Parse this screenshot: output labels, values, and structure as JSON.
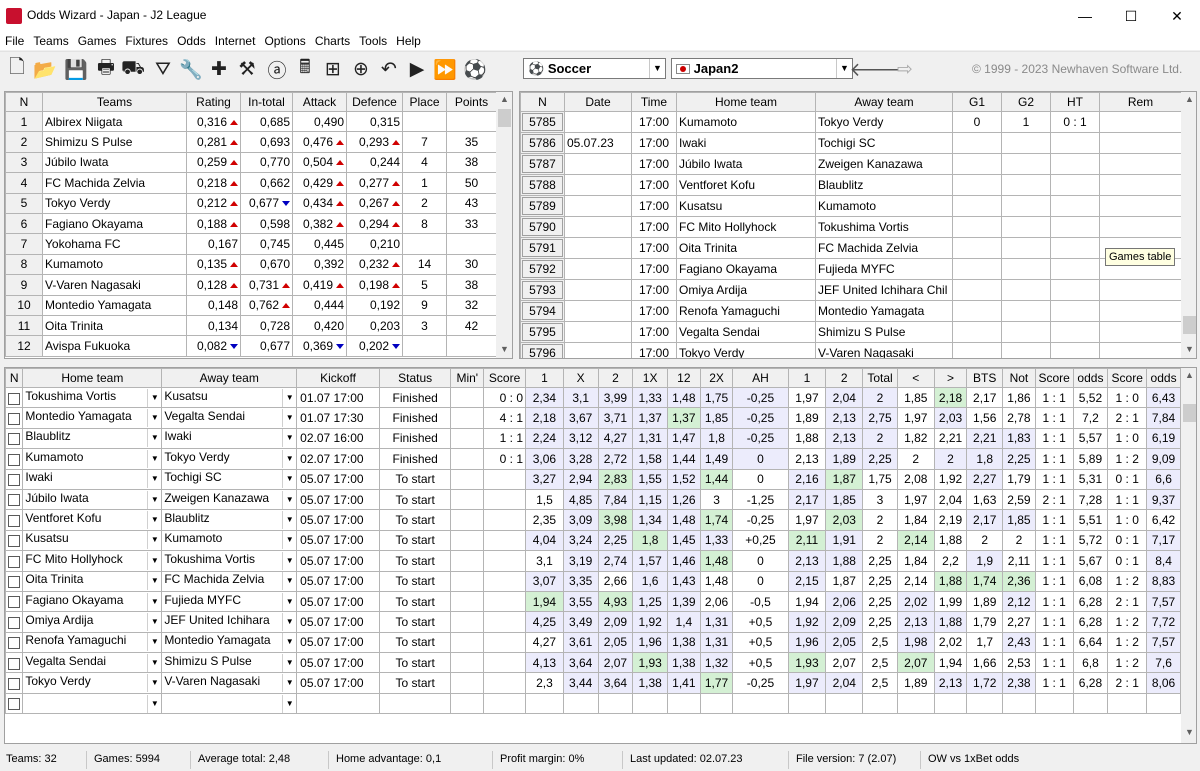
{
  "window": {
    "title": "Odds Wizard - Japan - J2 League",
    "minimize": "—",
    "maximize": "☐",
    "close": "✕"
  },
  "menu": [
    "File",
    "Teams",
    "Games",
    "Fixtures",
    "Odds",
    "Internet",
    "Options",
    "Charts",
    "Tools",
    "Help"
  ],
  "toolbar": {
    "icons": [
      "new-file-icon",
      "open-folder-icon",
      "save-icon",
      "print-icon",
      "print-preview-icon",
      "filter-icon",
      "wrench-icon",
      "medical-cross-icon",
      "tools-icon",
      "ai-icon",
      "calculator-icon",
      "hierarchy-icon",
      "search-icon",
      "undo-icon",
      "play-icon",
      "fast-forward-icon",
      "soccer-ball-icon"
    ],
    "sport": "Soccer",
    "league": "Japan2",
    "back": "🡐",
    "forward": "⇨",
    "copyright": "© 1999 - 2023 Newhaven Software Ltd."
  },
  "teams_table": {
    "headers": [
      "N",
      "Teams",
      "Rating",
      "In-total",
      "Attack",
      "Defence",
      "Place",
      "Points"
    ],
    "rows": [
      [
        "1",
        "Albirex Niigata",
        "0,316",
        "0,685",
        "0,490",
        "0,315",
        "",
        ""
      ],
      [
        "2",
        "Shimizu S Pulse",
        "0,281",
        "0,693",
        "0,476",
        "0,293",
        "7",
        "35"
      ],
      [
        "3",
        "Júbilo Iwata",
        "0,259",
        "0,770",
        "0,504",
        "0,244",
        "4",
        "38"
      ],
      [
        "4",
        "FC Machida Zelvia",
        "0,218",
        "0,662",
        "0,429",
        "0,277",
        "1",
        "50"
      ],
      [
        "5",
        "Tokyo Verdy",
        "0,212",
        "0,677",
        "0,434",
        "0,267",
        "2",
        "43"
      ],
      [
        "6",
        "Fagiano Okayama",
        "0,188",
        "0,598",
        "0,382",
        "0,294",
        "8",
        "33"
      ],
      [
        "7",
        "Yokohama FC",
        "0,167",
        "0,745",
        "0,445",
        "0,210",
        "",
        ""
      ],
      [
        "8",
        "Kumamoto",
        "0,135",
        "0,670",
        "0,392",
        "0,232",
        "14",
        "30"
      ],
      [
        "9",
        "V-Varen Nagasaki",
        "0,128",
        "0,731",
        "0,419",
        "0,198",
        "5",
        "38"
      ],
      [
        "10",
        "Montedio Yamagata",
        "0,148",
        "0,762",
        "0,444",
        "0,192",
        "9",
        "32"
      ],
      [
        "11",
        "Oita Trinita",
        "0,134",
        "0,728",
        "0,420",
        "0,203",
        "3",
        "42"
      ],
      [
        "12",
        "Avispa Fukuoka",
        "0,082",
        "0,677",
        "0,369",
        "0,202",
        "",
        ""
      ]
    ],
    "arrows": [
      [
        "up",
        "",
        "",
        ""
      ],
      [
        "up",
        "",
        "up",
        "up"
      ],
      [
        "up",
        "",
        "up",
        ""
      ],
      [
        "up",
        "",
        "up",
        "up"
      ],
      [
        "up",
        "dn",
        "up",
        "up"
      ],
      [
        "up",
        "",
        "up",
        "up"
      ],
      [
        "",
        "",
        "",
        ""
      ],
      [
        "up",
        "",
        "",
        "up"
      ],
      [
        "up",
        "up",
        "up",
        "up"
      ],
      [
        "",
        "up",
        "",
        ""
      ],
      [
        "",
        "",
        "",
        ""
      ],
      [
        "dn",
        "",
        "dn",
        "dn"
      ]
    ]
  },
  "games_table": {
    "headers": [
      "N",
      "Date",
      "Time",
      "Home team",
      "Away team",
      "G1",
      "G2",
      "HT",
      "Rem"
    ],
    "rows": [
      [
        "5785",
        "",
        "17:00",
        "Kumamoto",
        "Tokyo Verdy",
        "0",
        "1",
        "0 : 1",
        ""
      ],
      [
        "5786",
        "05.07.23",
        "17:00",
        "Iwaki",
        "Tochigi SC",
        "",
        "",
        "",
        ""
      ],
      [
        "5787",
        "",
        "17:00",
        "Júbilo Iwata",
        "Zweigen Kanazawa",
        "",
        "",
        "",
        ""
      ],
      [
        "5788",
        "",
        "17:00",
        "Ventforet Kofu",
        "Blaublitz",
        "",
        "",
        "",
        ""
      ],
      [
        "5789",
        "",
        "17:00",
        "Kusatsu",
        "Kumamoto",
        "",
        "",
        "",
        ""
      ],
      [
        "5790",
        "",
        "17:00",
        "FC Mito Hollyhock",
        "Tokushima Vortis",
        "",
        "",
        "",
        ""
      ],
      [
        "5791",
        "",
        "17:00",
        "Oita Trinita",
        "FC Machida Zelvia",
        "",
        "",
        "",
        ""
      ],
      [
        "5792",
        "",
        "17:00",
        "Fagiano Okayama",
        "Fujieda MYFC",
        "",
        "",
        "",
        ""
      ],
      [
        "5793",
        "",
        "17:00",
        "Omiya Ardija",
        "JEF United Ichihara Chil",
        "",
        "",
        "",
        ""
      ],
      [
        "5794",
        "",
        "17:00",
        "Renofa Yamaguchi",
        "Montedio Yamagata",
        "",
        "",
        "",
        ""
      ],
      [
        "5795",
        "",
        "17:00",
        "Vegalta Sendai",
        "Shimizu S Pulse",
        "",
        "",
        "",
        ""
      ],
      [
        "5796",
        "",
        "17:00",
        "Tokyo Verdy",
        "V-Varen Nagasaki",
        "",
        "",
        "",
        ""
      ]
    ]
  },
  "tooltip": "Games table",
  "fixtures_table": {
    "headers": [
      "N",
      "Home team",
      "Away team",
      "Kickoff",
      "Status",
      "Min'",
      "Score",
      "1",
      "X",
      "2",
      "1X",
      "12",
      "2X",
      "AH",
      "1",
      "2",
      "Total",
      "<",
      ">",
      "BTS",
      "Not",
      "Score",
      "odds",
      "Score",
      "odds"
    ],
    "rows": [
      [
        "Tokushima Vortis",
        "Kusatsu",
        "01.07 17:00",
        "Finished",
        "",
        "0 : 0",
        "2,34",
        "3,1",
        "3,99",
        "1,33",
        "1,48",
        "1,75",
        "-0,25",
        "1,97",
        "2,04",
        "2",
        "1,85",
        "2,18",
        "2,17",
        "1,86",
        "1 : 1",
        "5,52",
        "1 : 0",
        "6,43"
      ],
      [
        "Montedio Yamagata",
        "Vegalta Sendai",
        "01.07 17:30",
        "Finished",
        "",
        "4 : 1",
        "2,18",
        "3,67",
        "3,71",
        "1,37",
        "1,37",
        "1,85",
        "-0,25",
        "1,89",
        "2,13",
        "2,75",
        "1,97",
        "2,03",
        "1,56",
        "2,78",
        "1 : 1",
        "7,2",
        "2 : 1",
        "7,84"
      ],
      [
        "Blaublitz",
        "Iwaki",
        "02.07 16:00",
        "Finished",
        "",
        "1 : 1",
        "2,24",
        "3,12",
        "4,27",
        "1,31",
        "1,47",
        "1,8",
        "-0,25",
        "1,88",
        "2,13",
        "2",
        "1,82",
        "2,21",
        "2,21",
        "1,83",
        "1 : 1",
        "5,57",
        "1 : 0",
        "6,19"
      ],
      [
        "Kumamoto",
        "Tokyo Verdy",
        "02.07 17:00",
        "Finished",
        "",
        "0 : 1",
        "3,06",
        "3,28",
        "2,72",
        "1,58",
        "1,44",
        "1,49",
        "0",
        "2,13",
        "1,89",
        "2,25",
        "2",
        "2",
        "1,8",
        "2,25",
        "1 : 1",
        "5,89",
        "1 : 2",
        "9,09"
      ],
      [
        "Iwaki",
        "Tochigi SC",
        "05.07 17:00",
        "To start",
        "",
        "",
        "3,27",
        "2,94",
        "2,83",
        "1,55",
        "1,52",
        "1,44",
        "0",
        "2,16",
        "1,87",
        "1,75",
        "2,08",
        "1,92",
        "2,27",
        "1,79",
        "1 : 1",
        "5,31",
        "0 : 1",
        "6,6"
      ],
      [
        "Júbilo Iwata",
        "Zweigen Kanazawa",
        "05.07 17:00",
        "To start",
        "",
        "",
        "1,5",
        "4,85",
        "7,84",
        "1,15",
        "1,26",
        "3",
        "-1,25",
        "2,17",
        "1,85",
        "3",
        "1,97",
        "2,04",
        "1,63",
        "2,59",
        "2 : 1",
        "7,28",
        "1 : 1",
        "9,37"
      ],
      [
        "Ventforet Kofu",
        "Blaublitz",
        "05.07 17:00",
        "To start",
        "",
        "",
        "2,35",
        "3,09",
        "3,98",
        "1,34",
        "1,48",
        "1,74",
        "-0,25",
        "1,97",
        "2,03",
        "2",
        "1,84",
        "2,19",
        "2,17",
        "1,85",
        "1 : 1",
        "5,51",
        "1 : 0",
        "6,42"
      ],
      [
        "Kusatsu",
        "Kumamoto",
        "05.07 17:00",
        "To start",
        "",
        "",
        "4,04",
        "3,24",
        "2,25",
        "1,8",
        "1,45",
        "1,33",
        "+0,25",
        "2,11",
        "1,91",
        "2",
        "2,14",
        "1,88",
        "2",
        "2",
        "1 : 1",
        "5,72",
        "0 : 1",
        "7,17"
      ],
      [
        "FC Mito Hollyhock",
        "Tokushima Vortis",
        "05.07 17:00",
        "To start",
        "",
        "",
        "3,1",
        "3,19",
        "2,74",
        "1,57",
        "1,46",
        "1,48",
        "0",
        "2,13",
        "1,88",
        "2,25",
        "1,84",
        "2,2",
        "1,9",
        "2,11",
        "1 : 1",
        "5,67",
        "0 : 1",
        "8,4"
      ],
      [
        "Oita Trinita",
        "FC Machida Zelvia",
        "05.07 17:00",
        "To start",
        "",
        "",
        "3,07",
        "3,35",
        "2,66",
        "1,6",
        "1,43",
        "1,48",
        "0",
        "2,15",
        "1,87",
        "2,25",
        "2,14",
        "1,88",
        "1,74",
        "2,36",
        "1 : 1",
        "6,08",
        "1 : 2",
        "8,83"
      ],
      [
        "Fagiano Okayama",
        "Fujieda MYFC",
        "05.07 17:00",
        "To start",
        "",
        "",
        "1,94",
        "3,55",
        "4,93",
        "1,25",
        "1,39",
        "2,06",
        "-0,5",
        "1,94",
        "2,06",
        "2,25",
        "2,02",
        "1,99",
        "1,89",
        "2,12",
        "1 : 1",
        "6,28",
        "2 : 1",
        "7,57"
      ],
      [
        "Omiya Ardija",
        "JEF United Ichihara",
        "05.07 17:00",
        "To start",
        "",
        "",
        "4,25",
        "3,49",
        "2,09",
        "1,92",
        "1,4",
        "1,31",
        "+0,5",
        "1,92",
        "2,09",
        "2,25",
        "2,13",
        "1,88",
        "1,79",
        "2,27",
        "1 : 1",
        "6,28",
        "1 : 2",
        "7,72"
      ],
      [
        "Renofa Yamaguchi",
        "Montedio Yamagata",
        "05.07 17:00",
        "To start",
        "",
        "",
        "4,27",
        "3,61",
        "2,05",
        "1,96",
        "1,38",
        "1,31",
        "+0,5",
        "1,96",
        "2,05",
        "2,5",
        "1,98",
        "2,02",
        "1,7",
        "2,43",
        "1 : 1",
        "6,64",
        "1 : 2",
        "7,57"
      ],
      [
        "Vegalta Sendai",
        "Shimizu S Pulse",
        "05.07 17:00",
        "To start",
        "",
        "",
        "4,13",
        "3,64",
        "2,07",
        "1,93",
        "1,38",
        "1,32",
        "+0,5",
        "1,93",
        "2,07",
        "2,5",
        "2,07",
        "1,94",
        "1,66",
        "2,53",
        "1 : 1",
        "6,8",
        "1 : 2",
        "7,6"
      ],
      [
        "Tokyo Verdy",
        "V-Varen Nagasaki",
        "05.07 17:00",
        "To start",
        "",
        "",
        "2,3",
        "3,44",
        "3,64",
        "1,38",
        "1,41",
        "1,77",
        "-0,25",
        "1,97",
        "2,04",
        "2,5",
        "1,89",
        "2,13",
        "1,72",
        "2,38",
        "1 : 1",
        "6,28",
        "2 : 1",
        "8,06"
      ]
    ],
    "shading": [
      "bbbbbbbwbbwgwwwwwbwb",
      "bbbbgbbwbbwbwwwwwbwb",
      "bbbbbbbwbbwwbbwwwbww",
      "bbbbbbbwbbwbbbwwwbww",
      "bbgbbgwbgwwwbwwwwbww",
      "wbbbbwwbbwwwwwwwwbww",
      "wbgbbgwwgwwwbbwwwwww",
      "bbbgbbwgbwgwwwwwwbwb",
      "wbbbbgwbbwwwbwwwwbwb",
      "bbwbbwwbwwwgggwwwbww",
      "gbgbbwwwbwbwwbwwwbww",
      "bbbbbbwbbwbbwwwwwbww",
      "wbbbbbwbbwbwwbwwwbww",
      "bbbgbbwgwwgwwwwwwbww",
      "wbbbbgwbbwwbbbwwwbww"
    ]
  },
  "statusbar": {
    "teams": "Teams: 32",
    "games": "Games: 5994",
    "avg_total": "Average total: 2,48",
    "home_adv": "Home advantage: 0,1",
    "margin": "Profit margin: 0%",
    "updated": "Last updated: 02.07.23",
    "version": "File version: 7 (2.07)",
    "odds": "OW vs 1xBet odds"
  }
}
